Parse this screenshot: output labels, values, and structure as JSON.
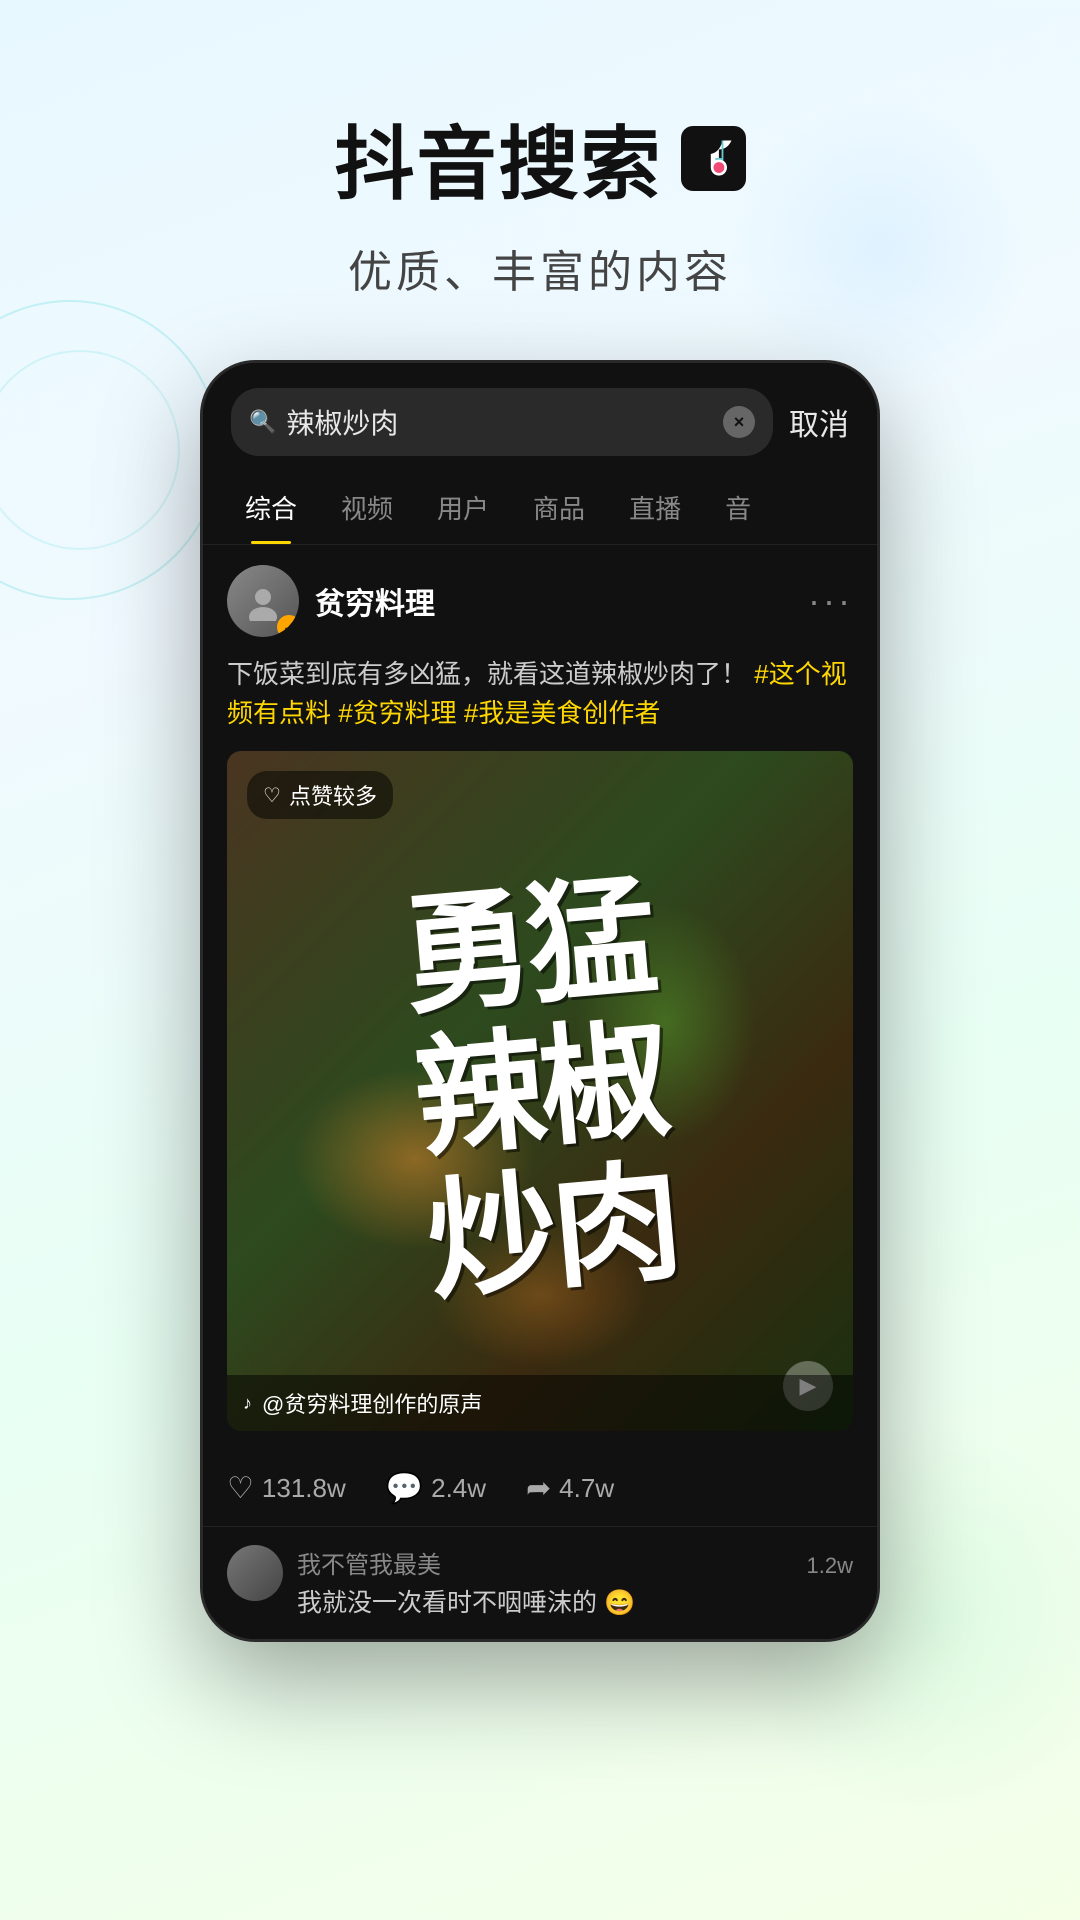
{
  "header": {
    "main_title": "抖音搜索",
    "subtitle": "优质、丰富的内容"
  },
  "search": {
    "query": "辣椒炒肉",
    "cancel_label": "取消"
  },
  "tabs": [
    {
      "label": "综合",
      "active": true
    },
    {
      "label": "视频",
      "active": false
    },
    {
      "label": "用户",
      "active": false
    },
    {
      "label": "商品",
      "active": false
    },
    {
      "label": "直播",
      "active": false
    },
    {
      "label": "音",
      "active": false
    }
  ],
  "post": {
    "username": "贫穷料理",
    "description_normal": "下饭菜到底有多凶猛，就看这道辣椒炒肉了！",
    "description_tags": "#这个视频有点料 #贫穷料理 #我是美食创作者",
    "likes_badge": "点赞较多",
    "video_text": "勇\n猛\n辣\n椒\n炒\n肉",
    "video_source": "@贫穷料理创作的原声",
    "stats": {
      "likes": "131.8w",
      "comments": "2.4w",
      "shares": "4.7w"
    }
  },
  "comment": {
    "username": "我不管我最美",
    "text": "我就没一次看时不咽唾沫的 😄",
    "count": "1.2w"
  },
  "icons": {
    "search": "🔍",
    "clear": "×",
    "more": "···",
    "heart": "♡",
    "comment": "💬",
    "share": "➦",
    "play": "▶",
    "tiktok_note": "♪"
  }
}
